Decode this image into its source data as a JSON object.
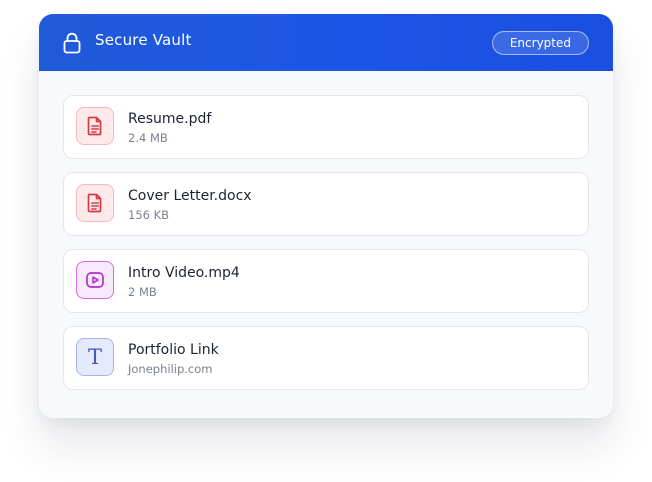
{
  "header": {
    "title": "Secure Vault",
    "badge": "Encrypted",
    "icon": "lock-icon"
  },
  "files": [
    {
      "name": "Resume.pdf",
      "meta": "2.4 MB",
      "icon": "document-icon",
      "color": "#d63a46"
    },
    {
      "name": "Cover Letter.docx",
      "meta": "156 KB",
      "icon": "document-icon",
      "color": "#d63a46"
    },
    {
      "name": "Intro Video.mp4",
      "meta": "2 MB",
      "icon": "video-icon",
      "color": "#b033c4"
    },
    {
      "name": "Portfolio Link",
      "meta": "Jonephilip.com",
      "icon": "text-icon",
      "glyph": "T",
      "color": "#4d57b8"
    }
  ],
  "colors": {
    "header_blue": "#1c56e6",
    "card_background": "#f8f9fc"
  }
}
